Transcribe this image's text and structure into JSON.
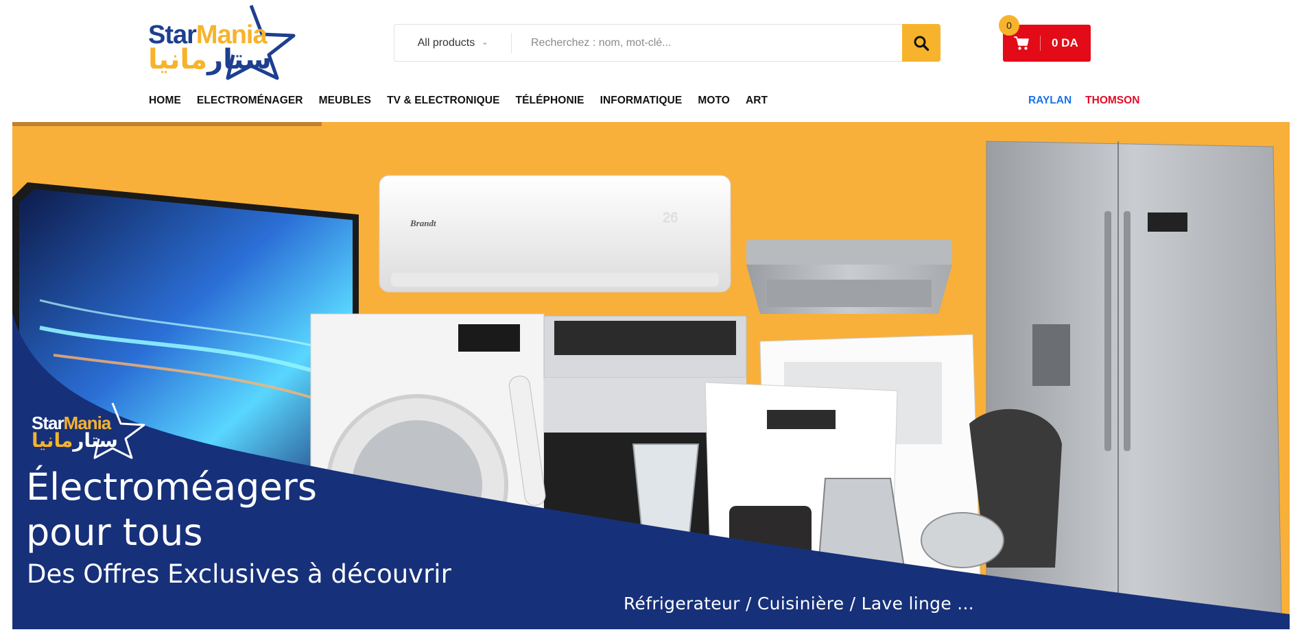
{
  "logo": {
    "latin_part1": "Star",
    "latin_part2": "Mania",
    "arabic_part1": "ستار",
    "arabic_part2": "مانيا"
  },
  "search": {
    "category_selected": "All products",
    "placeholder": "Recherchez : nom, mot-clé...",
    "button_icon": "search-icon"
  },
  "cart": {
    "count": "0",
    "total": "0 DA",
    "icon": "cart-icon"
  },
  "nav": {
    "items": [
      {
        "label": "HOME"
      },
      {
        "label": "ELECTROMÉNAGER"
      },
      {
        "label": "MEUBLES"
      },
      {
        "label": "TV & ELECTRONIQUE"
      },
      {
        "label": "TÉLÉPHONIE"
      },
      {
        "label": "INFORMATIQUE"
      },
      {
        "label": "MOTO"
      },
      {
        "label": "ART"
      }
    ],
    "brands": [
      {
        "label": "RAYLAN",
        "color": "#1a73e8"
      },
      {
        "label": "THOMSON",
        "color": "#e20b2a"
      }
    ]
  },
  "banner": {
    "headline_line1": "Électroméagers",
    "headline_line2": "pour tous",
    "subline": "Des Offres Exclusives à découvrir",
    "caption": "Réfrigerateur / Cuisinière / Lave linge ...",
    "appliance_brand_ac": "Brandt",
    "ac_display": "26",
    "colors": {
      "background": "#f8b03a",
      "panel": "#16307a",
      "accent": "#f7b32b"
    }
  }
}
